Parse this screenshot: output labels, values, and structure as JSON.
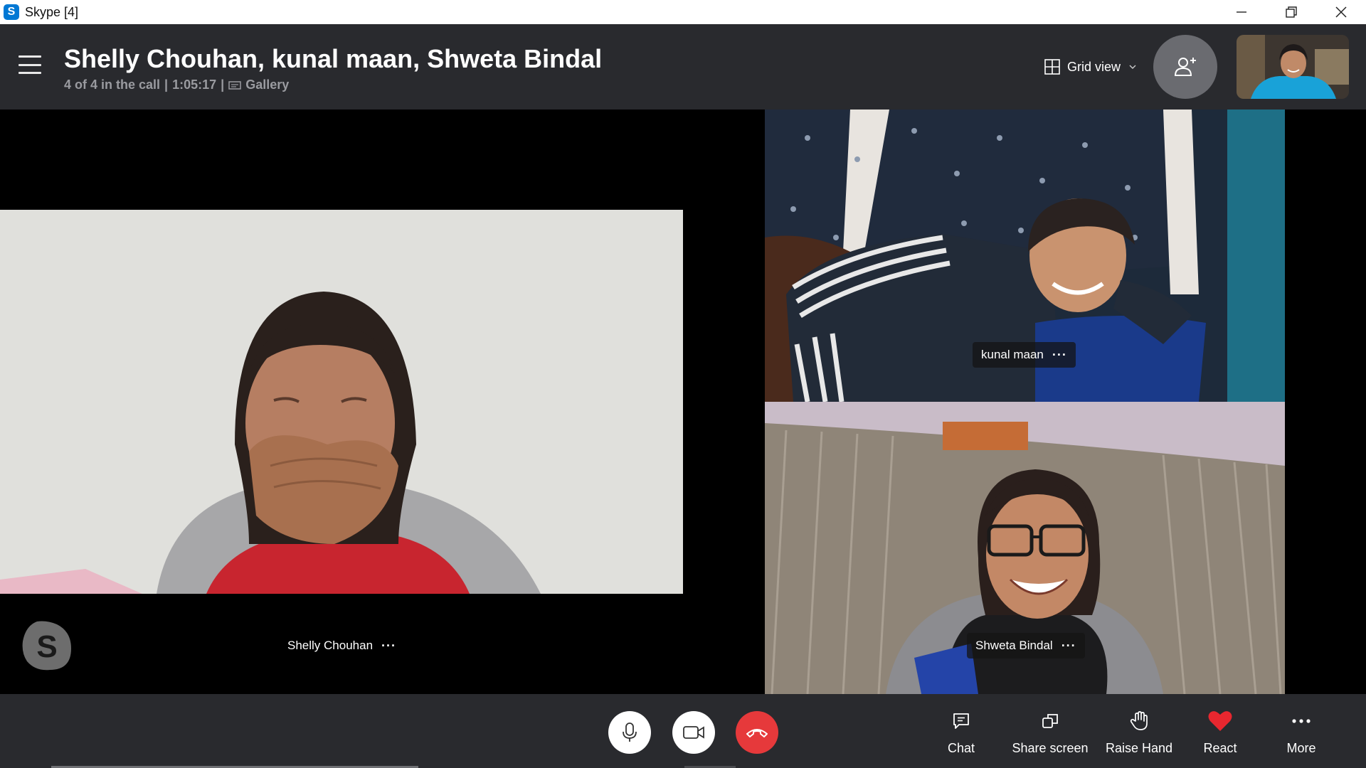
{
  "window": {
    "title": "Skype [4]",
    "logo_letter": "S",
    "controls": [
      "minimize-icon",
      "restore-icon",
      "close-icon"
    ]
  },
  "header": {
    "menu_icon": "hamburger-menu-icon",
    "title": "Shelly Chouhan, kunal maan, Shweta Bindal",
    "subtitle": {
      "count": "4 of 4 in the call",
      "separator": "|",
      "duration": "1:05:17",
      "layout_label": "Gallery"
    },
    "view_selector": {
      "label": "Grid view",
      "icon": "grid-icon"
    },
    "add_participant_icon": "add-person-icon"
  },
  "participants": [
    {
      "name": "Shelly Chouhan",
      "more": "···"
    },
    {
      "name": "kunal maan",
      "more": "···"
    },
    {
      "name": "Shweta Bindal",
      "more": "···"
    }
  ],
  "watermark_letter": "S",
  "controls": {
    "buttons": [
      "microphone-icon",
      "camera-icon",
      "hang-up-icon"
    ],
    "actions": [
      {
        "label": "Chat",
        "icon": "chat-icon"
      },
      {
        "label": "Share screen",
        "icon": "share-screen-icon"
      },
      {
        "label": "Raise Hand",
        "icon": "raise-hand-icon"
      },
      {
        "label": "React",
        "icon": "heart-icon"
      },
      {
        "label": "More",
        "icon": "more-icon"
      }
    ]
  },
  "colors": {
    "header_bg": "#292a2e",
    "hang_up": "#e6393b",
    "react_heart": "#e8272f",
    "skype_blue": "#0078d4"
  }
}
